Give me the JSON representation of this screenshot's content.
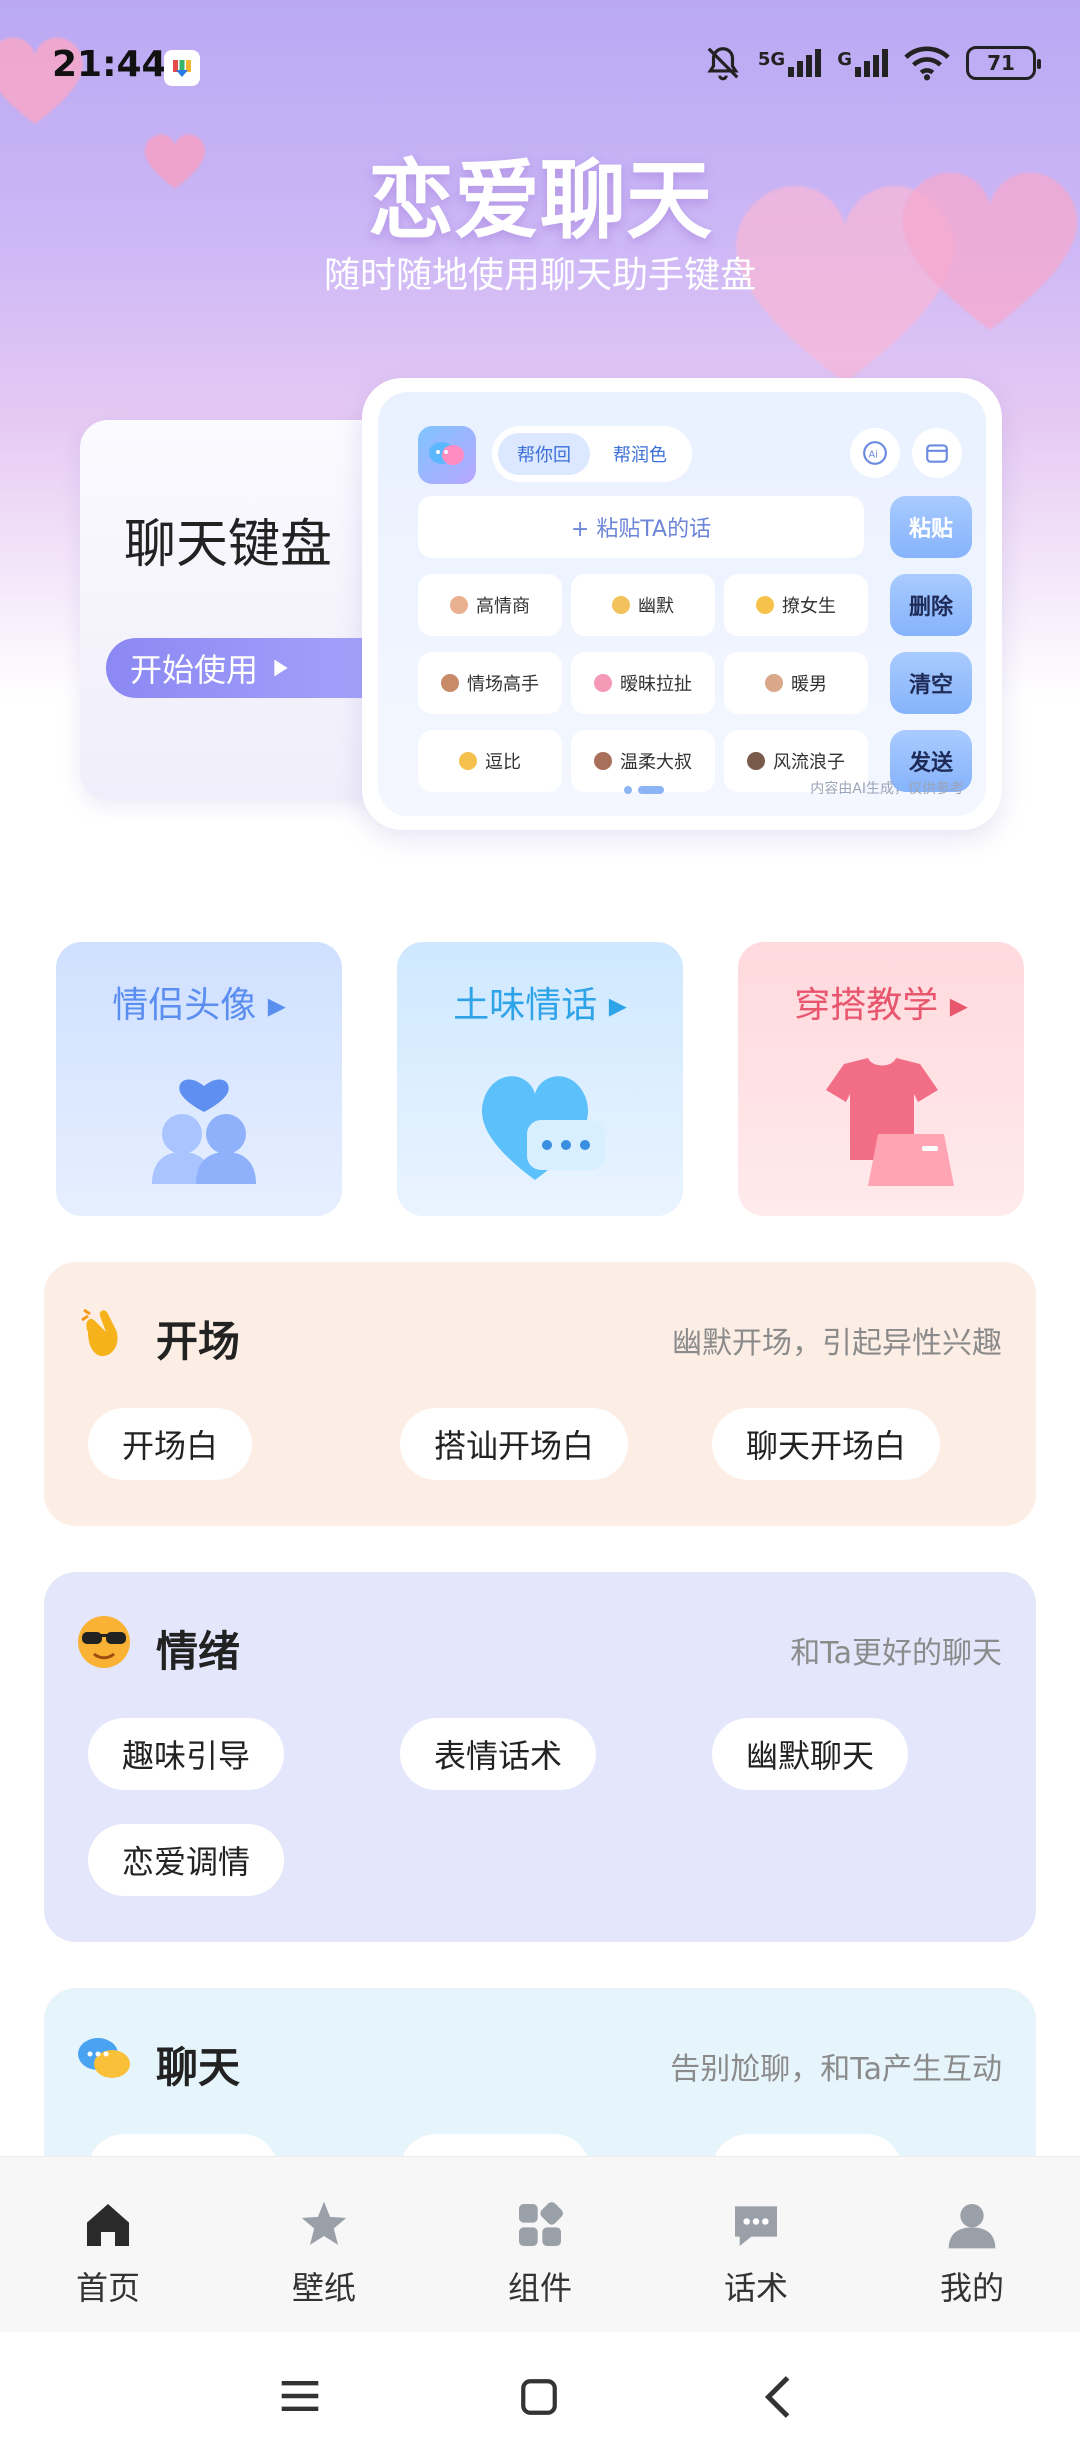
{
  "status_bar": {
    "time": "21:44",
    "signal_5g": "5G",
    "signal_g": "G",
    "battery": "71"
  },
  "hero": {
    "title": "恋爱聊天",
    "subtitle": "随时随地使用聊天助手键盘"
  },
  "keyboard_card": {
    "title": "聊天键盘",
    "start_label": "开始使用"
  },
  "keyboard_preview": {
    "tabs": [
      "帮你回",
      "帮润色"
    ],
    "paste_placeholder": "+ 粘贴TA的话",
    "side_buttons": [
      "粘贴",
      "删除",
      "清空",
      "发送"
    ],
    "styles": [
      "高情商",
      "幽默",
      "撩女生",
      "情场高手",
      "暧昧拉扯",
      "暖男",
      "逗比",
      "温柔大叔",
      "风流浪子"
    ],
    "note": "内容由AI生成，仅供参考"
  },
  "tiles": [
    {
      "title": "情侣头像",
      "color": "#5a8ef0"
    },
    {
      "title": "土味情话",
      "color": "#2fa3e8"
    },
    {
      "title": "穿搭教学",
      "color": "#e8566e"
    }
  ],
  "categories": {
    "opening": {
      "title": "开场",
      "desc": "幽默开场，引起异性兴趣",
      "items": [
        "开场白",
        "搭讪开场白",
        "聊天开场白"
      ]
    },
    "emotion": {
      "title": "情绪",
      "desc": "和Ta更好的聊天",
      "items": [
        "趣味引导",
        "表情话术",
        "幽默聊天",
        "恋爱调情"
      ]
    },
    "chat": {
      "title": "聊天",
      "desc": "告别尬聊，和Ta产生互动"
    }
  },
  "bottom_nav": [
    {
      "label": "首页",
      "icon": "home-icon"
    },
    {
      "label": "壁纸",
      "icon": "star-icon"
    },
    {
      "label": "组件",
      "icon": "widgets-icon"
    },
    {
      "label": "话术",
      "icon": "chat-icon"
    },
    {
      "label": "我的",
      "icon": "profile-icon"
    }
  ]
}
